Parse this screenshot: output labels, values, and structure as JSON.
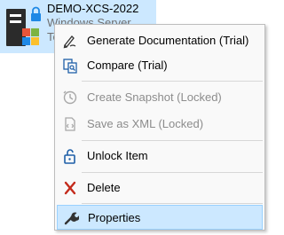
{
  "desktop_item": {
    "title": "DEMO-XCS-2022",
    "subtitle": "Windows Server",
    "subtitle_partial": "Te",
    "icon": "server-icon"
  },
  "context_menu": {
    "items": [
      {
        "label": "Generate Documentation (Trial)",
        "icon": "pen-document-icon",
        "enabled": true
      },
      {
        "label": "Compare (Trial)",
        "icon": "compare-icon",
        "enabled": true
      },
      {
        "label": "Create Snapshot (Locked)",
        "icon": "snapshot-icon",
        "enabled": false
      },
      {
        "label": "Save as XML (Locked)",
        "icon": "xml-file-icon",
        "enabled": false
      },
      {
        "label": "Unlock Item",
        "icon": "unlock-icon",
        "enabled": true
      },
      {
        "label": "Delete",
        "icon": "delete-x-icon",
        "enabled": true
      },
      {
        "label": "Properties",
        "icon": "wrench-icon",
        "enabled": true,
        "highlighted": true
      }
    ]
  },
  "colors": {
    "selection": "#cce8ff",
    "selection_border": "#99d1ff",
    "menu_bg": "#f9f9f9",
    "disabled_text": "#8c8c8c",
    "accent_blue": "#1e5fa8",
    "delete_red": "#c42b1c"
  }
}
